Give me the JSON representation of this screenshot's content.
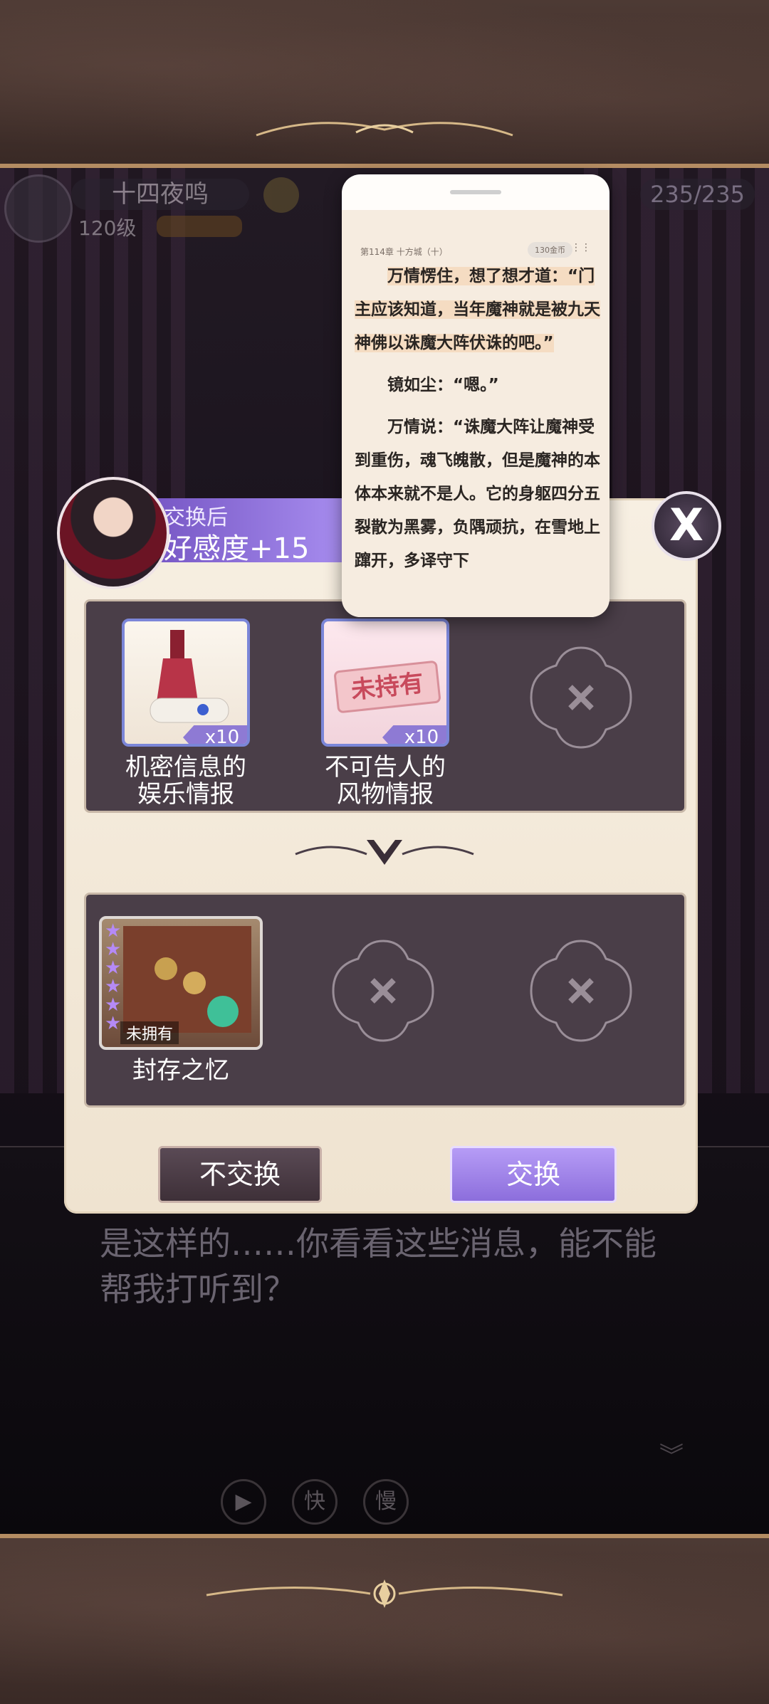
{
  "hud": {
    "player_name": "十四夜鸣",
    "level": "120级",
    "resource_count": "235/235"
  },
  "modal": {
    "banner_caption": "交换后",
    "banner_value": "好感度+15",
    "close_label": "X",
    "give_items": [
      {
        "label_line1": "机密信息的",
        "label_line2": "娱乐情报",
        "qty": "x10"
      },
      {
        "label_line1": "不可告人的",
        "label_line2": "风物情报",
        "qty": "x10",
        "stamp": "未持有"
      }
    ],
    "receive_items": [
      {
        "label": "封存之忆",
        "status": "未拥有",
        "stars": 6
      }
    ],
    "btn_decline": "不交换",
    "btn_accept": "交换"
  },
  "dialog": {
    "line": "是这样的……你看看这些消息，能不能帮我打听到？"
  },
  "controls": {
    "play_icon": "play-icon",
    "fast": "快",
    "slow": "慢"
  },
  "reader": {
    "chapter": "第114章 十方城（十）",
    "chip": "130金币",
    "para1": "万情愣住，想了想才道：“门主应该知道，当年魔神就是被九天神佛以诛魔大阵伏诛的吧。”",
    "para2": "镜如尘：“嗯。”",
    "para3": "万情说：“诛魔大阵让魔神受到重伤，魂飞魄散，但是魔神的本体本来就不是人。它的身躯四分五裂散为黑雾，负隅顽抗，在雪地上蹿开，多译守下"
  },
  "colors": {
    "accent_purple": "#8c6edc",
    "panel_cream": "#f7efe2",
    "slot_bg": "#4a3e48",
    "frame_brown": "#4d3a34"
  }
}
